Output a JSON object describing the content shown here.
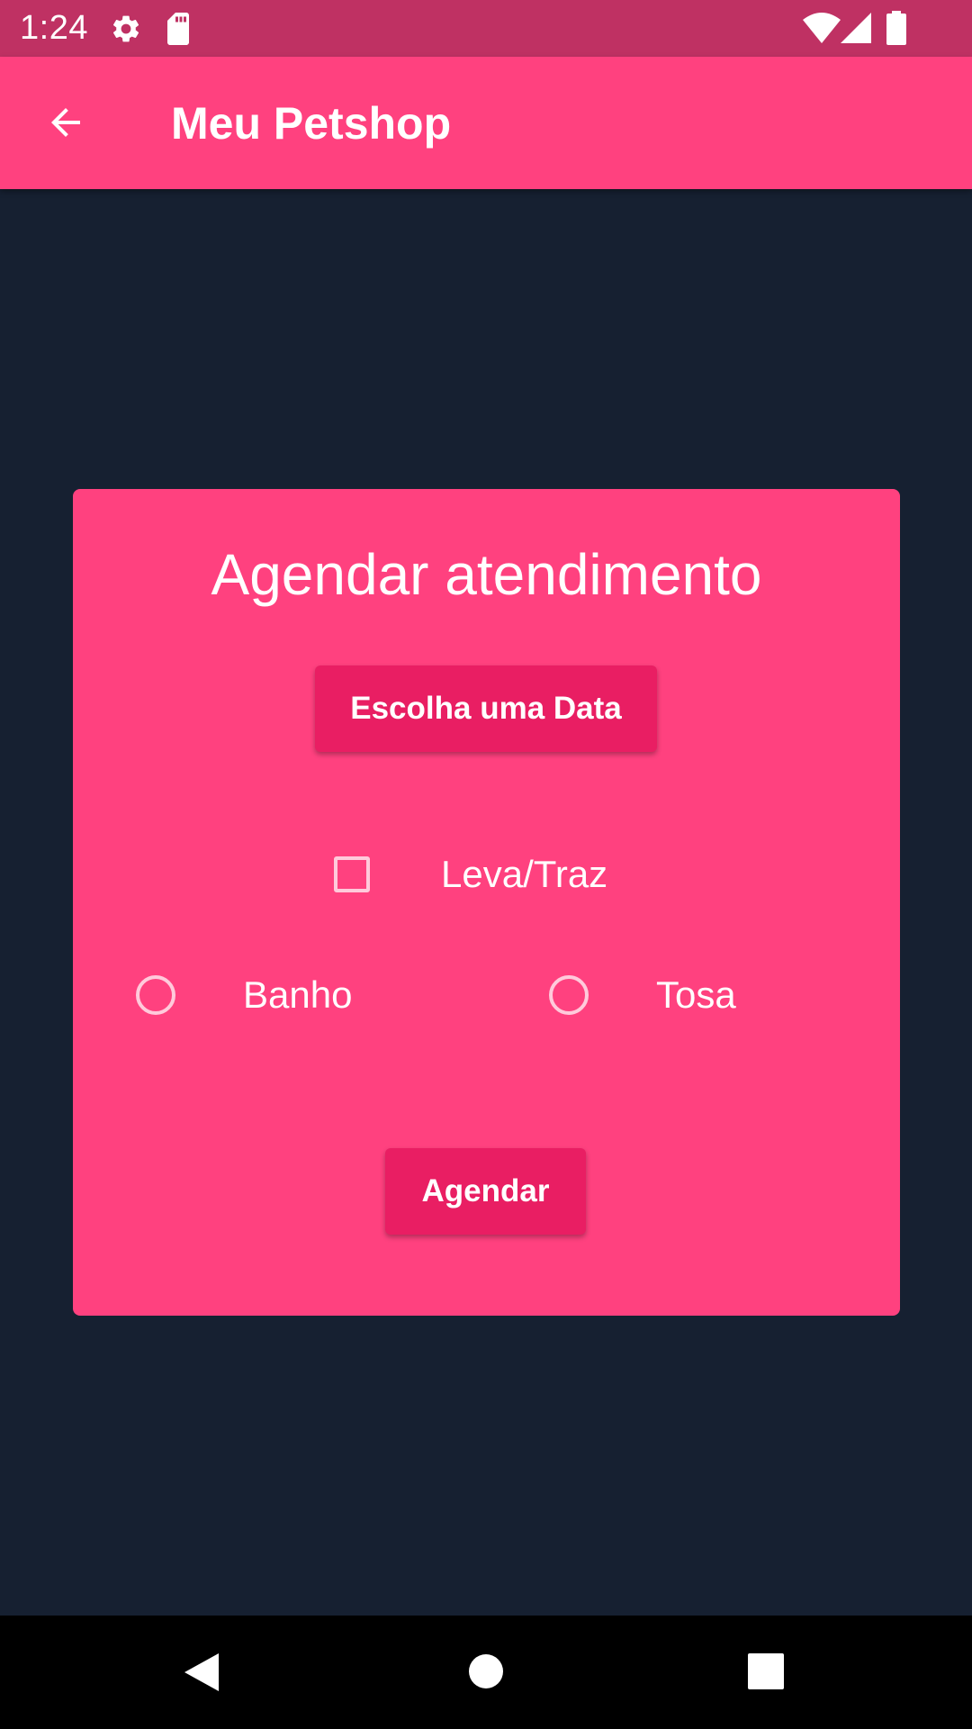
{
  "status_bar": {
    "time": "1:24",
    "icons": [
      "gear-icon",
      "sd-card-icon",
      "wifi-icon",
      "signal-icon",
      "battery-icon"
    ],
    "background": "#bf3163"
  },
  "app_bar": {
    "title": "Meu Petshop",
    "back_icon": "arrow-back-icon",
    "background": "#ff417f"
  },
  "card": {
    "title": "Agendar atendimento",
    "date_button_label": "Escolha uma Data",
    "checkbox": {
      "label": "Leva/Traz",
      "checked": false
    },
    "radio_options": [
      {
        "label": "Banho",
        "selected": false
      },
      {
        "label": "Tosa",
        "selected": false
      }
    ],
    "submit_button_label": "Agendar",
    "background": "#ff417f",
    "button_color": "#e91e63"
  },
  "nav_bar": {
    "buttons": [
      "back-triangle-icon",
      "home-circle-icon",
      "recents-square-icon"
    ]
  },
  "colors": {
    "page_background": "#162031"
  }
}
